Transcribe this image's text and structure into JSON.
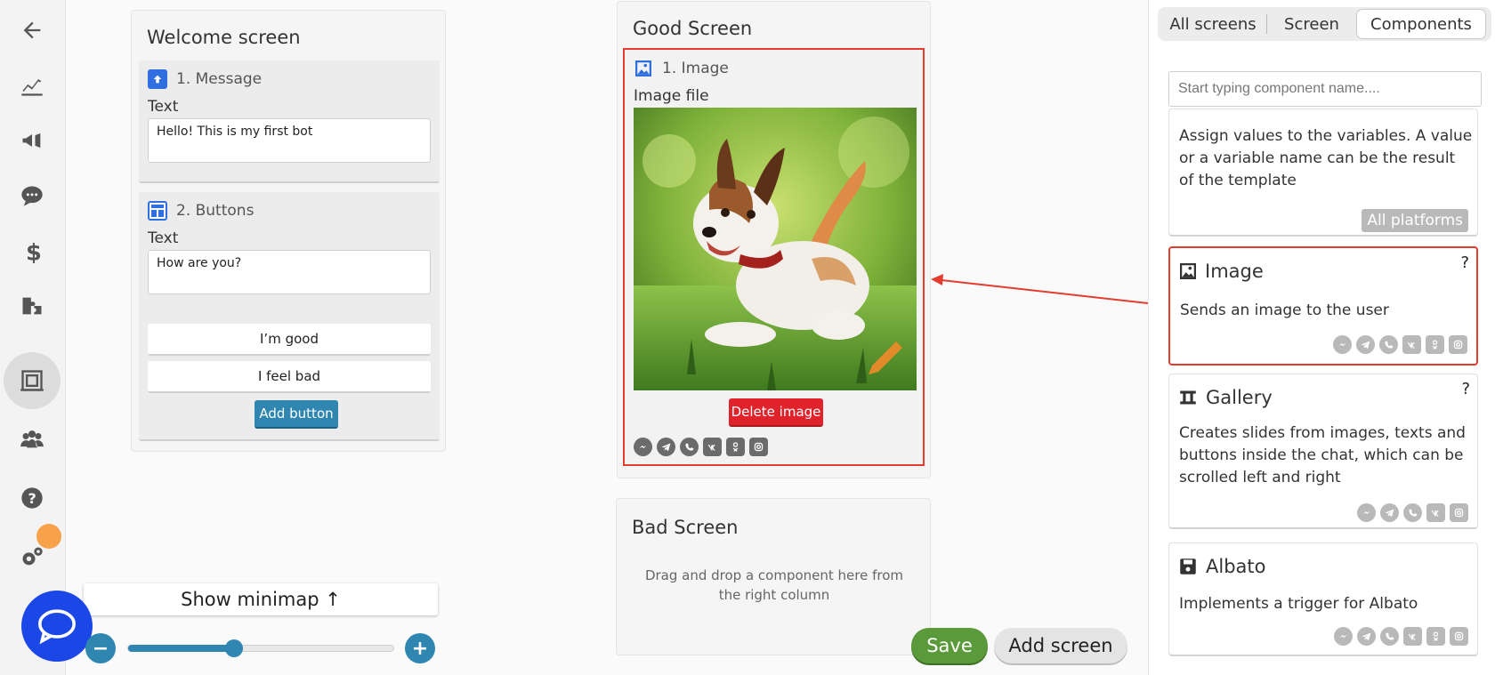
{
  "nav": {
    "items": [
      "back-icon",
      "analytics-icon",
      "broadcast-icon",
      "chat-icon",
      "billing-icon",
      "integrations-icon",
      "builder-icon",
      "users-icon",
      "help-icon",
      "settings-icon"
    ]
  },
  "welcome": {
    "title": "Welcome screen",
    "message": {
      "header": "1. Message",
      "label": "Text",
      "value": "Hello! This is my first bot"
    },
    "buttons": {
      "header": "2. Buttons",
      "label": "Text",
      "value": "How are you?",
      "options": [
        "I’m good",
        "I feel bad"
      ],
      "add_label": "Add button"
    }
  },
  "good": {
    "title": "Good Screen",
    "image": {
      "header": "1. Image",
      "label": "Image file",
      "delete_label": "Delete image"
    }
  },
  "bad": {
    "title": "Bad Screen",
    "hint": "Drag and drop a component here from the right column"
  },
  "controls": {
    "minimap_label": "Show minimap ↑",
    "zoom_out": "−",
    "zoom_in": "+",
    "zoom_level": 0.4,
    "save_label": "Save",
    "add_screen_label": "Add screen"
  },
  "sidebar": {
    "tabs": [
      "All screens",
      "Screen",
      "Components"
    ],
    "active_tab": "Components",
    "search_placeholder": "Start typing component name....",
    "cards": [
      {
        "title": "",
        "desc": "Assign values to the variables. A value or a variable name can be the result of the template",
        "badge": "All platforms"
      },
      {
        "title": "Image",
        "desc": "Sends an image to the user",
        "help": "?"
      },
      {
        "title": "Gallery",
        "desc": "Creates slides from images, texts and buttons inside the chat, which can be scrolled left and right",
        "help": "?"
      },
      {
        "title": "Albato",
        "desc": "Implements a trigger for Albato"
      }
    ]
  },
  "colors": {
    "accent": "#2f86b0",
    "highlight": "#e43d30",
    "danger": "#e0222b",
    "save": "#5a9a3a",
    "fab": "#1a47e6"
  }
}
